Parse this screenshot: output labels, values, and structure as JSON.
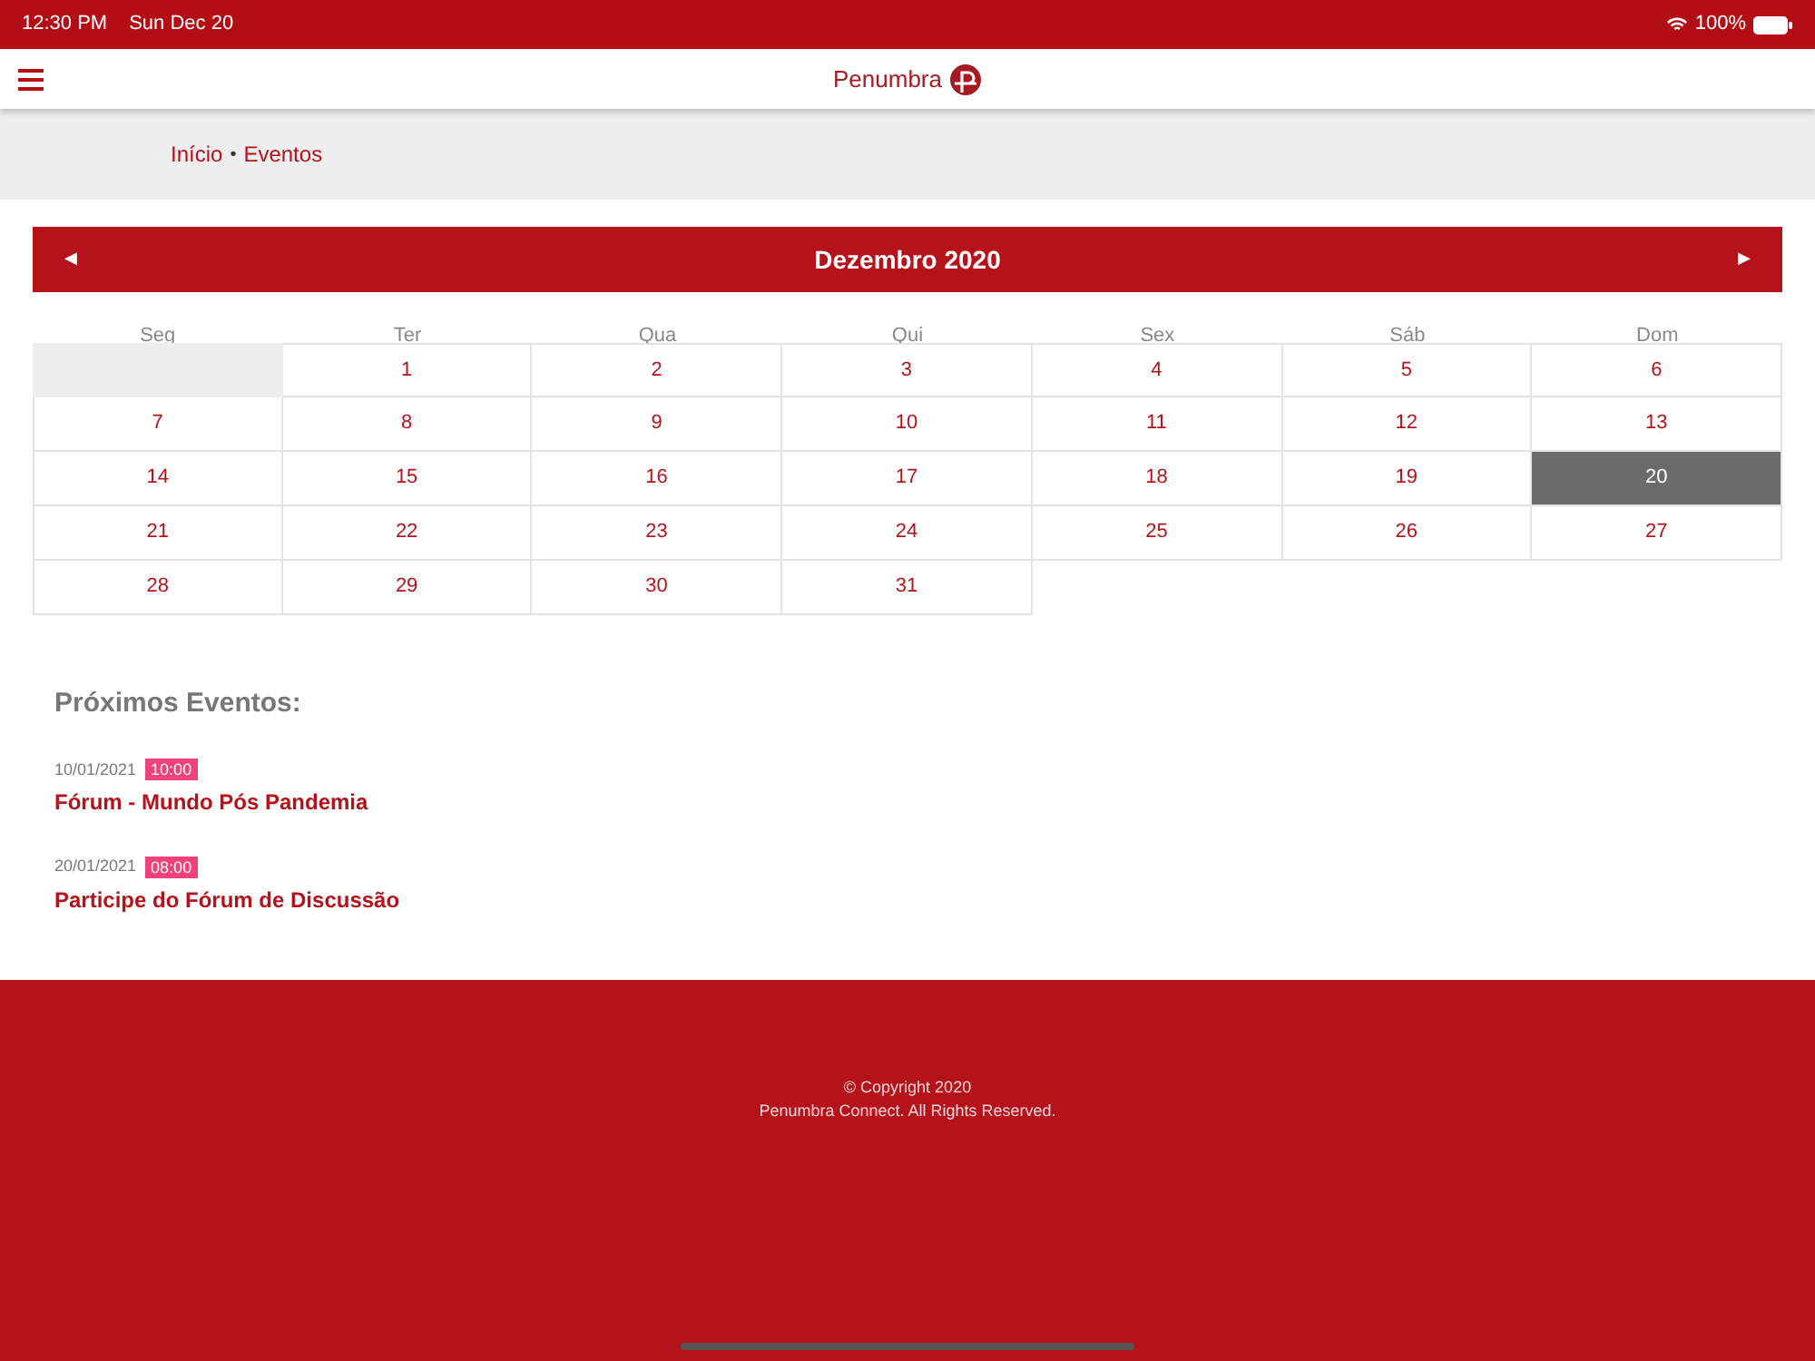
{
  "status_bar": {
    "time": "12:30 PM",
    "date": "Sun Dec 20",
    "battery": "100%"
  },
  "header": {
    "logo_text": "Penumbra"
  },
  "breadcrumb": {
    "items": [
      "Início",
      "Eventos"
    ],
    "separator": "•"
  },
  "calendar": {
    "title": "Dezembro 2020",
    "prev": "◀",
    "next": "▶",
    "weekdays": [
      "Seg",
      "Ter",
      "Qua",
      "Qui",
      "Sex",
      "Sáb",
      "Dom"
    ],
    "weeks": [
      [
        {
          "kind": "empty"
        },
        {
          "kind": "day",
          "label": "1",
          "selected": false
        },
        {
          "kind": "day",
          "label": "2",
          "selected": false
        },
        {
          "kind": "day",
          "label": "3",
          "selected": false
        },
        {
          "kind": "day",
          "label": "4",
          "selected": false
        },
        {
          "kind": "day",
          "label": "5",
          "selected": false
        },
        {
          "kind": "day",
          "label": "6",
          "selected": false
        }
      ],
      [
        {
          "kind": "day",
          "label": "7",
          "selected": false
        },
        {
          "kind": "day",
          "label": "8",
          "selected": false
        },
        {
          "kind": "day",
          "label": "9",
          "selected": false
        },
        {
          "kind": "day",
          "label": "10",
          "selected": false
        },
        {
          "kind": "day",
          "label": "11",
          "selected": false
        },
        {
          "kind": "day",
          "label": "12",
          "selected": false
        },
        {
          "kind": "day",
          "label": "13",
          "selected": false
        }
      ],
      [
        {
          "kind": "day",
          "label": "14",
          "selected": false
        },
        {
          "kind": "day",
          "label": "15",
          "selected": false
        },
        {
          "kind": "day",
          "label": "16",
          "selected": false
        },
        {
          "kind": "day",
          "label": "17",
          "selected": false
        },
        {
          "kind": "day",
          "label": "18",
          "selected": false
        },
        {
          "kind": "day",
          "label": "19",
          "selected": false
        },
        {
          "kind": "day",
          "label": "20",
          "selected": true
        }
      ],
      [
        {
          "kind": "day",
          "label": "21",
          "selected": false
        },
        {
          "kind": "day",
          "label": "22",
          "selected": false
        },
        {
          "kind": "day",
          "label": "23",
          "selected": false
        },
        {
          "kind": "day",
          "label": "24",
          "selected": false
        },
        {
          "kind": "day",
          "label": "25",
          "selected": false
        },
        {
          "kind": "day",
          "label": "26",
          "selected": false
        },
        {
          "kind": "day",
          "label": "27",
          "selected": false
        }
      ],
      [
        {
          "kind": "day",
          "label": "28",
          "selected": false
        },
        {
          "kind": "day",
          "label": "29",
          "selected": false
        },
        {
          "kind": "day",
          "label": "30",
          "selected": false
        },
        {
          "kind": "day",
          "label": "31",
          "selected": false
        },
        {
          "kind": "blank"
        },
        {
          "kind": "blank"
        },
        {
          "kind": "blank"
        }
      ]
    ]
  },
  "events": {
    "heading": "Próximos Eventos:",
    "items": [
      {
        "date": "10/01/2021",
        "time": "10:00",
        "title": "Fórum - Mundo Pós Pandemia"
      },
      {
        "date": "20/01/2021",
        "time": "08:00",
        "title": "Participe do Fórum de Discussão"
      }
    ]
  },
  "footer": {
    "lines": [
      "© Copyright 2020",
      "Penumbra Connect. All Rights Reserved."
    ]
  }
}
